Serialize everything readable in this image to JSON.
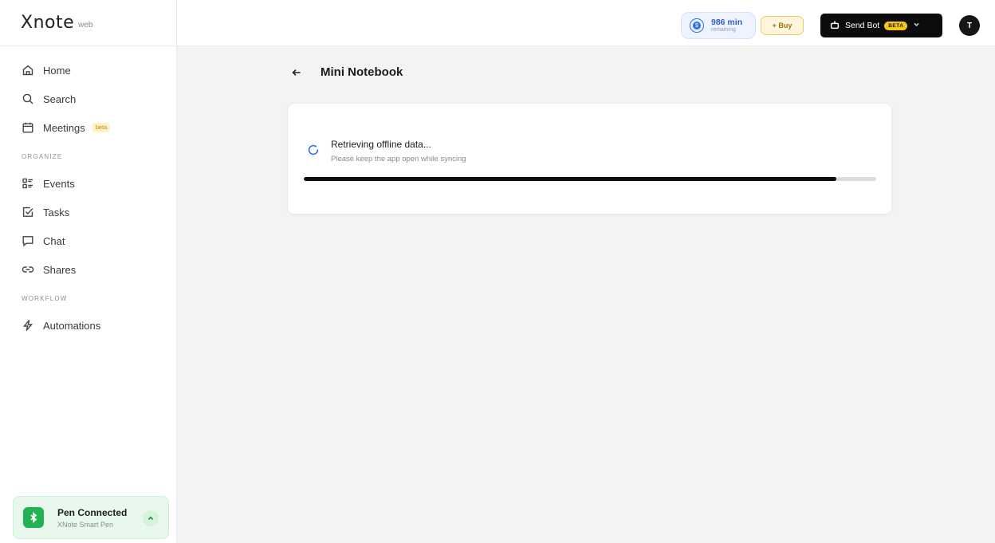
{
  "brand": {
    "logo": "Xnote",
    "sub": "web"
  },
  "sidebar": {
    "items": [
      {
        "label": "Home",
        "icon": "home-icon"
      },
      {
        "label": "Search",
        "icon": "search-icon"
      },
      {
        "label": "Meetings",
        "icon": "calendar-icon",
        "badge": "beta"
      }
    ],
    "organize_label": "ORGANIZE",
    "organize_items": [
      {
        "label": "Events",
        "icon": "events-list-icon"
      },
      {
        "label": "Tasks",
        "icon": "task-check-icon"
      },
      {
        "label": "Chat",
        "icon": "chat-bubble-icon"
      },
      {
        "label": "Shares",
        "icon": "link-icon"
      }
    ],
    "workflow_label": "WORKFLOW",
    "workflow_items": [
      {
        "label": "Automations",
        "icon": "lightning-icon"
      }
    ],
    "pen": {
      "title": "Pen Connected",
      "subtitle": "XNote Smart Pen",
      "icon": "bluetooth-icon"
    }
  },
  "topbar": {
    "minutes_value": "986 min",
    "minutes_label": "remaining",
    "buy_label": "+ Buy",
    "send_bot_label": "Send Bot",
    "send_bot_badge": "BETA",
    "avatar_initial": "T"
  },
  "main": {
    "title": "Mini Notebook",
    "sync_title": "Retrieving offline data...",
    "sync_subtitle": "Please keep the app open while syncing",
    "progress_fraction": 0.93
  },
  "colors": {
    "accent_blue": "#2f6fe8",
    "pen_green": "#22b153",
    "buy_gold": "#f0c966",
    "beta_yellow": "#f5c518"
  }
}
